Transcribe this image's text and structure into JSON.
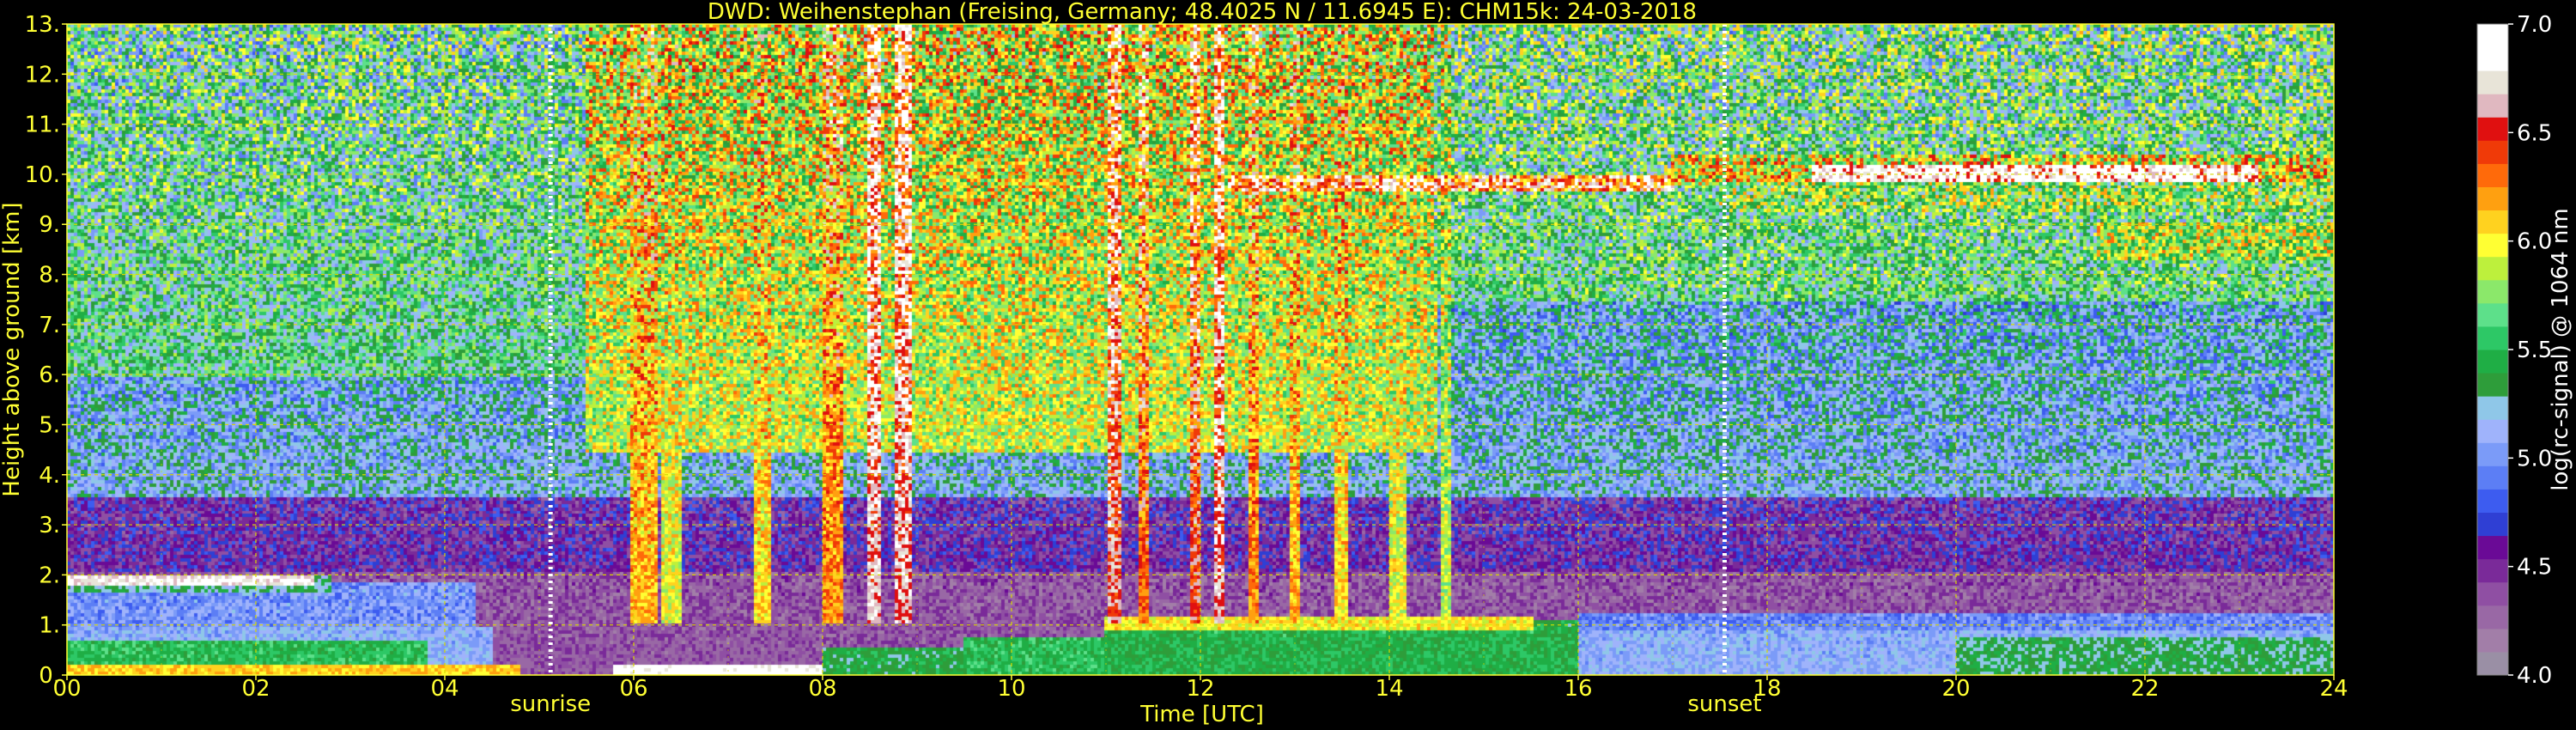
{
  "chart_data": {
    "type": "heatmap",
    "title": "DWD: Weihenstephan (Freising, Germany; 48.4025 N / 11.6945 E):    CHM15k: 24-03-2018",
    "xlabel": "Time [UTC]",
    "ylabel": "Height above ground [km]",
    "xlim": [
      0,
      24
    ],
    "ylim": [
      0,
      13
    ],
    "grid": true,
    "x_ticks": [
      {
        "value": 0,
        "label": "00"
      },
      {
        "value": 2,
        "label": "02"
      },
      {
        "value": 4,
        "label": "04"
      },
      {
        "value": 6,
        "label": "06"
      },
      {
        "value": 8,
        "label": "08"
      },
      {
        "value": 10,
        "label": "10"
      },
      {
        "value": 12,
        "label": "12"
      },
      {
        "value": 14,
        "label": "14"
      },
      {
        "value": 16,
        "label": "16"
      },
      {
        "value": 18,
        "label": "18"
      },
      {
        "value": 20,
        "label": "20"
      },
      {
        "value": 22,
        "label": "22"
      },
      {
        "value": 24,
        "label": "24"
      }
    ],
    "y_ticks": [
      {
        "value": 0,
        "label": "0."
      },
      {
        "value": 1,
        "label": "1."
      },
      {
        "value": 2,
        "label": "2."
      },
      {
        "value": 3,
        "label": "3."
      },
      {
        "value": 4,
        "label": "4."
      },
      {
        "value": 5,
        "label": "5."
      },
      {
        "value": 6,
        "label": "6."
      },
      {
        "value": 7,
        "label": "7."
      },
      {
        "value": 8,
        "label": "8."
      },
      {
        "value": 9,
        "label": "9."
      },
      {
        "value": 10,
        "label": "10."
      },
      {
        "value": 11,
        "label": "11."
      },
      {
        "value": 12,
        "label": "12."
      },
      {
        "value": 13,
        "label": "13."
      }
    ],
    "annotations": [
      {
        "name": "sunrise",
        "label": "sunrise",
        "x": 5.12
      },
      {
        "name": "sunset",
        "label": "sunset",
        "x": 17.55
      }
    ],
    "colorbar": {
      "label": "log(rc-signal) @ 1064 nm",
      "range": [
        4.0,
        7.0
      ],
      "ticks": [
        {
          "value": 4.0,
          "label": "4.0"
        },
        {
          "value": 4.5,
          "label": "4.5"
        },
        {
          "value": 5.0,
          "label": "5.0"
        },
        {
          "value": 5.5,
          "label": "5.5"
        },
        {
          "value": 6.0,
          "label": "6.0"
        },
        {
          "value": 6.5,
          "label": "6.5"
        },
        {
          "value": 7.0,
          "label": "7.0"
        }
      ],
      "colors": [
        "#9a8fa5",
        "#a27ea8",
        "#9968a5",
        "#8f4fa3",
        "#7a2a99",
        "#6a0a96",
        "#2f3fd4",
        "#3d5cf0",
        "#5c7ef5",
        "#7b9bf8",
        "#9fb3fb",
        "#8fc7e8",
        "#2e9d3a",
        "#1fae45",
        "#2dc866",
        "#5de08a",
        "#8be86a",
        "#bdf03c",
        "#ffff33",
        "#ffd21f",
        "#ffa010",
        "#ff6a0a",
        "#f03a08",
        "#e01010",
        "#e0b8c0",
        "#e8e4d8",
        "#ffffff",
        "#ffffff"
      ]
    },
    "bands": [
      {
        "t0": 0,
        "t1": 24,
        "z0": 0,
        "z1": 13,
        "v": 5.15
      },
      {
        "t0": 0,
        "t1": 5.5,
        "z0": 6,
        "z1": 13,
        "v": 5.45
      },
      {
        "t0": 5.5,
        "t1": 14.5,
        "z0": 4.5,
        "z1": 13,
        "v": 5.9
      },
      {
        "t0": 14.5,
        "t1": 24,
        "z0": 7.5,
        "z1": 13,
        "v": 5.5
      },
      {
        "t0": 0,
        "t1": 24,
        "z0": 0,
        "z1": 3.5,
        "v": 4.55
      },
      {
        "t0": 0,
        "t1": 24,
        "z0": 0,
        "z1": 2,
        "v": 4.35
      },
      {
        "t0": 0,
        "t1": 4.3,
        "z0": 0.9,
        "z1": 1.8,
        "v": 5.0
      },
      {
        "t0": 0,
        "t1": 2.8,
        "z0": 1.65,
        "z1": 1.95,
        "v": 5.3
      },
      {
        "t0": 0,
        "t1": 2.6,
        "z0": 1.8,
        "z1": 1.95,
        "v": 6.8
      },
      {
        "t0": 0,
        "t1": 4.5,
        "z0": 0.0,
        "z1": 0.9,
        "v": 5.1
      },
      {
        "t0": 0,
        "t1": 3.8,
        "z0": 0.15,
        "z1": 0.65,
        "v": 5.5
      },
      {
        "t0": 0,
        "t1": 4.8,
        "z0": 0,
        "z1": 0.15,
        "v": 6.1
      },
      {
        "t0": 5.8,
        "t1": 8.0,
        "z0": 0,
        "z1": 0.15,
        "v": 6.9
      },
      {
        "t0": 8.0,
        "t1": 9.5,
        "z0": 0,
        "z1": 0.5,
        "v": 5.4
      },
      {
        "t0": 9.5,
        "t1": 11.0,
        "z0": 0,
        "z1": 0.75,
        "v": 5.5
      },
      {
        "t0": 11.0,
        "t1": 16.0,
        "z0": 0,
        "z1": 1.05,
        "v": 5.45
      },
      {
        "t0": 11.0,
        "t1": 15.5,
        "z0": 0.9,
        "z1": 1.15,
        "v": 6.0
      },
      {
        "t0": 16.0,
        "t1": 24,
        "z0": 0,
        "z1": 1.0,
        "v": 5.1
      },
      {
        "t0": 16.0,
        "t1": 24,
        "z0": 0.9,
        "z1": 1.2,
        "v": 4.95
      },
      {
        "t0": 20.0,
        "t1": 24,
        "z0": 0,
        "z1": 0.7,
        "v": 5.35
      },
      {
        "t0": 12.3,
        "t1": 17.0,
        "z0": 9.7,
        "z1": 9.95,
        "v": 6.5
      },
      {
        "t0": 17.0,
        "t1": 24,
        "z0": 9.8,
        "z1": 10.35,
        "v": 6.0
      },
      {
        "t0": 18.5,
        "t1": 23.2,
        "z0": 9.9,
        "z1": 10.15,
        "v": 6.9
      },
      {
        "t0": 17.5,
        "t1": 24,
        "z0": 9.3,
        "z1": 9.8,
        "v": 5.7
      },
      {
        "t0": 21.5,
        "t1": 24,
        "z0": 8.3,
        "z1": 9.0,
        "v": 5.8
      }
    ],
    "streaks": [
      {
        "t": 6.1,
        "w": 0.25,
        "v": 6.4
      },
      {
        "t": 6.4,
        "w": 0.2,
        "v": 6.2
      },
      {
        "t": 7.35,
        "w": 0.15,
        "v": 6.3
      },
      {
        "t": 8.1,
        "w": 0.2,
        "v": 6.5
      },
      {
        "t": 8.55,
        "w": 0.1,
        "v": 6.9
      },
      {
        "t": 8.85,
        "w": 0.12,
        "v": 6.9
      },
      {
        "t": 11.1,
        "w": 0.12,
        "v": 6.8
      },
      {
        "t": 11.4,
        "w": 0.08,
        "v": 6.6
      },
      {
        "t": 11.95,
        "w": 0.1,
        "v": 6.7
      },
      {
        "t": 12.2,
        "w": 0.06,
        "v": 6.9
      },
      {
        "t": 12.55,
        "w": 0.08,
        "v": 6.5
      },
      {
        "t": 13.0,
        "w": 0.05,
        "v": 6.4
      },
      {
        "t": 13.5,
        "w": 0.1,
        "v": 6.3
      },
      {
        "t": 14.1,
        "w": 0.15,
        "v": 6.2
      },
      {
        "t": 14.6,
        "w": 0.1,
        "v": 6.1
      }
    ]
  }
}
